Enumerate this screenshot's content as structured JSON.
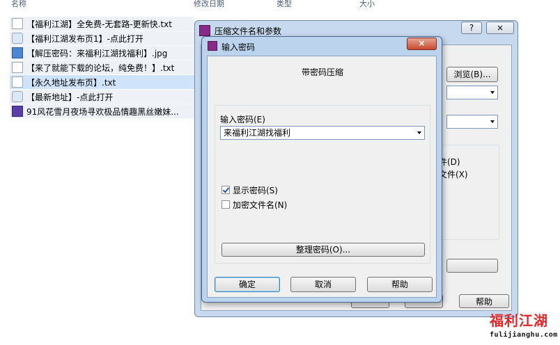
{
  "explorer": {
    "columns": [
      "名称",
      "修改日期",
      "类型",
      "大小"
    ],
    "files": [
      {
        "name": "【福利江湖】全免费-无套路-更新快.txt",
        "icon": "text-file-icon"
      },
      {
        "name": "【福利江湖发布页1】-点此打开",
        "icon": "shortcut-icon"
      },
      {
        "name": "【解压密码：来福利江湖找福利】.jpg",
        "icon": "image-file-icon"
      },
      {
        "name": "【来了就能下载的论坛，纯免费！】.txt",
        "icon": "text-file-icon"
      },
      {
        "name": "【永久地址发布页】.txt",
        "icon": "text-file-icon"
      },
      {
        "name": "【最新地址】-点此打开",
        "icon": "shortcut-icon"
      },
      {
        "name": "91风花雪月夜场寻欢极品情趣黑丝嫩妹...",
        "icon": "video-file-icon"
      }
    ]
  },
  "background_dialog": {
    "title": "压缩文件名和参数",
    "help_caption": "?",
    "close_caption": "×",
    "browse_label": "浏览(B)...",
    "option_d_partial": "件(D)",
    "option_x_partial": "文件(X)",
    "help_button": "帮助"
  },
  "dialog": {
    "title": "输入密码",
    "close_caption": "×",
    "heading": "带密码压缩",
    "password_label": "输入密码(E)",
    "password_value": "来福利江湖找福利",
    "show_password_label": "显示密码(S)",
    "show_password_checked": true,
    "encrypt_names_label": "加密文件名(N)",
    "encrypt_names_checked": false,
    "organize_label": "整理密码(O)...",
    "ok_label": "确定",
    "cancel_label": "取消",
    "help_label": "帮助"
  },
  "watermark": {
    "brand": "福利江湖",
    "url": "fulijianghu.com",
    "color": "#e0282a"
  }
}
